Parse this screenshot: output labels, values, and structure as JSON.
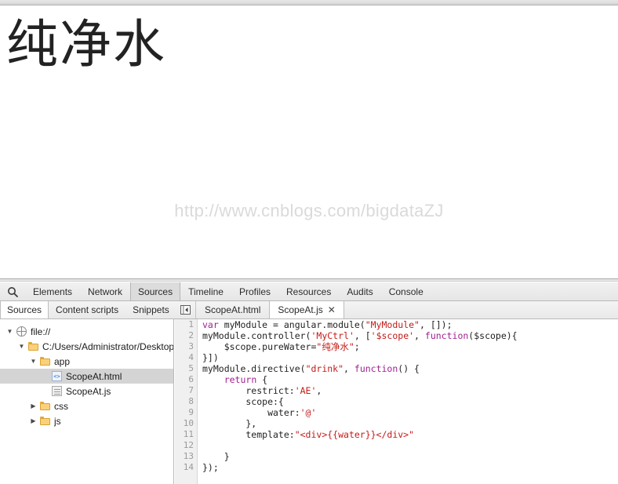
{
  "page": {
    "heading": "纯净水",
    "watermark": "http://www.cnblogs.com/bigdataZJ"
  },
  "devtools": {
    "search_icon": "search-icon",
    "panel_tabs": [
      {
        "label": "Elements",
        "selected": false
      },
      {
        "label": "Network",
        "selected": false
      },
      {
        "label": "Sources",
        "selected": true
      },
      {
        "label": "Timeline",
        "selected": false
      },
      {
        "label": "Profiles",
        "selected": false
      },
      {
        "label": "Resources",
        "selected": false
      },
      {
        "label": "Audits",
        "selected": false
      },
      {
        "label": "Console",
        "selected": false
      }
    ],
    "nav_subtabs": [
      {
        "label": "Sources",
        "selected": true
      },
      {
        "label": "Content scripts",
        "selected": false
      },
      {
        "label": "Snippets",
        "selected": false
      }
    ],
    "sidebar_toggle_icon": "panel-collapse-icon",
    "editor_tabs": [
      {
        "label": "ScopeAt.html",
        "selected": false,
        "closable": false,
        "close_label": ""
      },
      {
        "label": "ScopeAt.js",
        "selected": true,
        "closable": true,
        "close_label": "✕"
      }
    ],
    "navigator": {
      "rows": [
        {
          "label": "file://",
          "indent": 0,
          "disclosure": "▼",
          "icon": "globe-icon",
          "selected": false
        },
        {
          "label": "C:/Users/Administrator/Desktop/",
          "indent": 1,
          "disclosure": "▼",
          "icon": "folder-icon",
          "selected": false
        },
        {
          "label": "app",
          "indent": 2,
          "disclosure": "▼",
          "icon": "folder-icon",
          "selected": false
        },
        {
          "label": "ScopeAt.html",
          "indent": 3,
          "disclosure": "",
          "icon": "html-file-icon",
          "selected": true
        },
        {
          "label": "ScopeAt.js",
          "indent": 3,
          "disclosure": "",
          "icon": "js-file-icon",
          "selected": false
        },
        {
          "label": "css",
          "indent": 2,
          "disclosure": "▶",
          "icon": "folder-icon",
          "selected": false
        },
        {
          "label": "js",
          "indent": 2,
          "disclosure": "▶",
          "icon": "folder-icon",
          "selected": false
        }
      ]
    },
    "editor": {
      "line_numbers": [
        "1",
        "2",
        "3",
        "4",
        "5",
        "6",
        "7",
        "8",
        "9",
        "10",
        "11",
        "12",
        "13",
        "14"
      ],
      "lines": [
        [
          {
            "t": "var ",
            "c": "kw"
          },
          {
            "t": "myModule = angular.module(",
            "c": "pln"
          },
          {
            "t": "\"MyModule\"",
            "c": "str"
          },
          {
            "t": ", []);",
            "c": "pln"
          }
        ],
        [
          {
            "t": "myModule.controller(",
            "c": "pln"
          },
          {
            "t": "'MyCtrl'",
            "c": "str"
          },
          {
            "t": ", [",
            "c": "pln"
          },
          {
            "t": "'$scope'",
            "c": "str"
          },
          {
            "t": ", ",
            "c": "pln"
          },
          {
            "t": "function",
            "c": "kw"
          },
          {
            "t": "($scope){",
            "c": "pln"
          }
        ],
        [
          {
            "t": "    $scope.pureWater=",
            "c": "pln"
          },
          {
            "t": "\"纯净水\"",
            "c": "str"
          },
          {
            "t": ";",
            "c": "pln"
          }
        ],
        [
          {
            "t": "}])",
            "c": "pln"
          }
        ],
        [
          {
            "t": "myModule.directive(",
            "c": "pln"
          },
          {
            "t": "\"drink\"",
            "c": "str"
          },
          {
            "t": ", ",
            "c": "pln"
          },
          {
            "t": "function",
            "c": "kw"
          },
          {
            "t": "() {",
            "c": "pln"
          }
        ],
        [
          {
            "t": "    ",
            "c": "pln"
          },
          {
            "t": "return",
            "c": "kw"
          },
          {
            "t": " {",
            "c": "pln"
          }
        ],
        [
          {
            "t": "        restrict:",
            "c": "pln"
          },
          {
            "t": "'AE'",
            "c": "str"
          },
          {
            "t": ",",
            "c": "pln"
          }
        ],
        [
          {
            "t": "        scope:{",
            "c": "pln"
          }
        ],
        [
          {
            "t": "            water:",
            "c": "pln"
          },
          {
            "t": "'@'",
            "c": "str"
          }
        ],
        [
          {
            "t": "        },",
            "c": "pln"
          }
        ],
        [
          {
            "t": "        template:",
            "c": "pln"
          },
          {
            "t": "\"<div>{{water}}</div>\"",
            "c": "str"
          }
        ],
        [
          {
            "t": "",
            "c": "pln"
          }
        ],
        [
          {
            "t": "    }",
            "c": "pln"
          }
        ],
        [
          {
            "t": "});",
            "c": "pln"
          }
        ]
      ]
    }
  },
  "colors": {
    "keyword": "#a11f91",
    "string": "#c41a16",
    "plain": "#222222",
    "gutter_bg": "#f0f0f0",
    "selected_row": "#d4d4d4",
    "toolbar_bg": "#e9e9e9"
  }
}
